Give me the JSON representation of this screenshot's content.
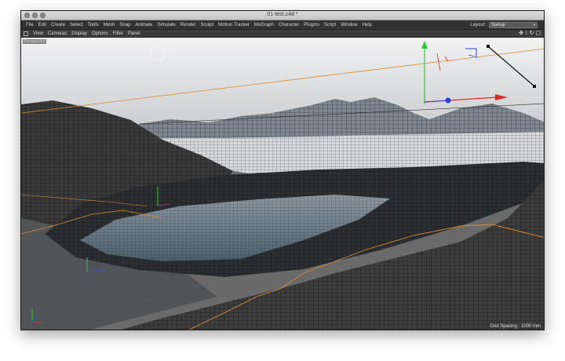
{
  "window": {
    "title": "01-test.c4d *"
  },
  "menubar": {
    "items": [
      "File",
      "Edit",
      "Create",
      "Select",
      "Tools",
      "Mesh",
      "Snap",
      "Animate",
      "Simulate",
      "Render",
      "Sculpt",
      "Motion Tracker",
      "MoGraph",
      "Character",
      "Plugins",
      "Script",
      "Window",
      "Help"
    ],
    "layout_label": "Layout:",
    "layout_value": "Startup"
  },
  "viewbar": {
    "items": [
      "View",
      "Cameras",
      "Display",
      "Options",
      "Filter",
      "Panel"
    ],
    "nav_icons": [
      "move-icon",
      "zoom-icon",
      "rotate-icon",
      "maximize-icon"
    ]
  },
  "viewport": {
    "camera_label": "Perspective",
    "grid_spacing": "Grid Spacing : 1000 mm"
  },
  "colors": {
    "menubar_bg": "#323232",
    "viewport_sky": "#dcdcde",
    "terrain_dark": "#2a2a2a",
    "water": "#6f8597",
    "selection_orange": "#e08a2c",
    "axis_x": "#e02a2a",
    "axis_y": "#2ad02a",
    "axis_z": "#2a40e0"
  }
}
